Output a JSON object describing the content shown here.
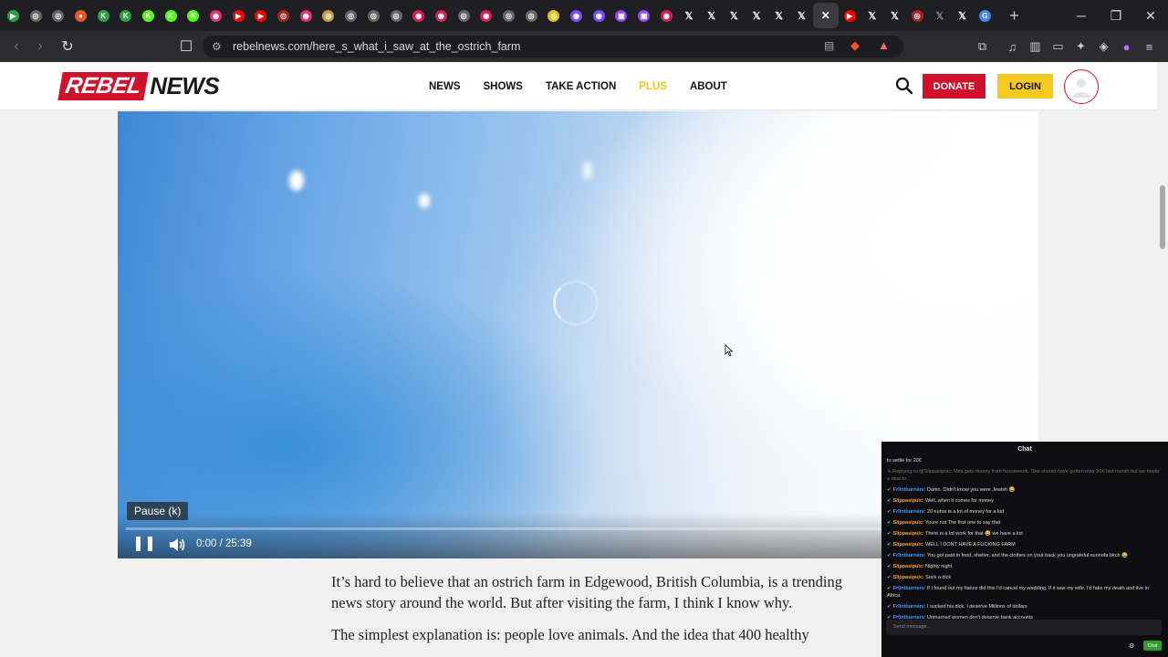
{
  "browser": {
    "tab_favicons": [
      {
        "icon": "play-icon",
        "color": "#2ea043",
        "glyph": "▶"
      },
      {
        "icon": "circle-icon",
        "color": "#666666",
        "glyph": "◎"
      },
      {
        "icon": "circle-icon",
        "color": "#666666",
        "glyph": "◎"
      },
      {
        "icon": "circle-icon",
        "color": "#e05a2a",
        "glyph": "●"
      },
      {
        "icon": "kick-icon",
        "color": "#2ea043",
        "glyph": "K"
      },
      {
        "icon": "kick-icon",
        "color": "#2ea043",
        "glyph": "K"
      },
      {
        "icon": "kick-icon",
        "color": "#53fc18",
        "glyph": "K"
      },
      {
        "icon": "kick-icon",
        "color": "#53fc18",
        "glyph": "K"
      },
      {
        "icon": "kick-icon",
        "color": "#53fc18",
        "glyph": "K"
      },
      {
        "icon": "instagram-icon",
        "color": "#e1306c",
        "glyph": "◉"
      },
      {
        "icon": "youtube-icon",
        "color": "#ff0000",
        "glyph": "▶"
      },
      {
        "icon": "youtube-icon",
        "color": "#ff0000",
        "glyph": "▶"
      },
      {
        "icon": "circle-icon",
        "color": "#aa2222",
        "glyph": "◎"
      },
      {
        "icon": "instagram-icon",
        "color": "#e1306c",
        "glyph": "◉"
      },
      {
        "icon": "circle-icon",
        "color": "#c0a040",
        "glyph": "◎"
      },
      {
        "icon": "circle-icon",
        "color": "#666666",
        "glyph": "◎"
      },
      {
        "icon": "circle-icon",
        "color": "#666666",
        "glyph": "◎"
      },
      {
        "icon": "circle-icon",
        "color": "#666666",
        "glyph": "◎"
      },
      {
        "icon": "circle-icon",
        "color": "#cc2255",
        "glyph": "◉"
      },
      {
        "icon": "circle-icon",
        "color": "#cc2255",
        "glyph": "◉"
      },
      {
        "icon": "circle-icon",
        "color": "#666666",
        "glyph": "◎"
      },
      {
        "icon": "circle-icon",
        "color": "#cc2255",
        "glyph": "◉"
      },
      {
        "icon": "circle-icon",
        "color": "#666666",
        "glyph": "◎"
      },
      {
        "icon": "circle-icon",
        "color": "#666666",
        "glyph": "◎"
      },
      {
        "icon": "circle-icon",
        "color": "#e0c020",
        "glyph": "◎"
      },
      {
        "icon": "circle-icon",
        "color": "#7b4bff",
        "glyph": "◉"
      },
      {
        "icon": "circle-icon",
        "color": "#7b4bff",
        "glyph": "◉"
      },
      {
        "icon": "twitch-icon",
        "color": "#9146ff",
        "glyph": "▣"
      },
      {
        "icon": "twitch-icon",
        "color": "#9146ff",
        "glyph": "▣"
      },
      {
        "icon": "circle-icon",
        "color": "#cc2255",
        "glyph": "◉"
      },
      {
        "icon": "x-icon",
        "color": "#ffffff",
        "glyph": "𝕏"
      },
      {
        "icon": "x-icon",
        "color": "#ffffff",
        "glyph": "𝕏"
      },
      {
        "icon": "x-icon",
        "color": "#ffffff",
        "glyph": "𝕏"
      },
      {
        "icon": "x-icon",
        "color": "#ffffff",
        "glyph": "𝕏"
      },
      {
        "icon": "x-icon",
        "color": "#ffffff",
        "glyph": "𝕏"
      },
      {
        "icon": "x-icon",
        "color": "#ffffff",
        "glyph": "𝕏"
      },
      {
        "icon": "close-icon",
        "color": "#ffffff",
        "glyph": "✕",
        "active": true
      },
      {
        "icon": "youtube-icon",
        "color": "#ff0000",
        "glyph": "▶"
      },
      {
        "icon": "x-icon",
        "color": "#ffffff",
        "glyph": "𝕏"
      },
      {
        "icon": "x-icon",
        "color": "#ffffff",
        "glyph": "𝕏"
      },
      {
        "icon": "circle-icon",
        "color": "#aa2222",
        "glyph": "◎"
      },
      {
        "icon": "x-icon",
        "color": "#888888",
        "glyph": "𝕏"
      },
      {
        "icon": "x-icon",
        "color": "#ffffff",
        "glyph": "𝕏"
      },
      {
        "icon": "google-icon",
        "color": "#4285f4",
        "glyph": "G"
      }
    ],
    "url": "rebelnews.com/here_s_what_i_saw_at_the_ostrich_farm"
  },
  "site": {
    "logo_rebel": "REBEL",
    "logo_news": "NEWS",
    "nav": [
      {
        "label": "NEWS"
      },
      {
        "label": "SHOWS"
      },
      {
        "label": "TAKE ACTION"
      },
      {
        "label": "PLUS",
        "accent": "#f1c40f"
      },
      {
        "label": "ABOUT"
      }
    ],
    "donate_label": "DONATE",
    "login_label": "LOGIN",
    "brand_color": "#d0112b",
    "login_color": "#f7c81e"
  },
  "video": {
    "tooltip": "Pause (k)",
    "time": "0:00 / 25:39",
    "progress": 0
  },
  "article": {
    "paragraphs": [
      "It’s hard to believe that an ostrich farm in Edgewood, British Columbia, is a trending news story around the world. But after visiting the farm, I think I know why.",
      "The simplest explanation is: people love animals. And the idea that 400 healthy"
    ]
  },
  "chat": {
    "title": "Chat",
    "lines": [
      {
        "user": "",
        "text": "to settle for 20€",
        "type": "plain"
      },
      {
        "user": "",
        "text": "↳ Replying to @Slippasipulc: Mini gets money from hossiework. She should have gotten over 80€ last month but we made a deal to…",
        "type": "reply"
      },
      {
        "user": "Fr0ntburners",
        "text": "Damn. Didn't know you were Jewish 😂",
        "type": "u1"
      },
      {
        "user": "Slippasipulc",
        "text": "Well..when it comes for money",
        "type": "u2"
      },
      {
        "user": "Fr0ntburners",
        "text": "20 euros is a lot of money for a kid",
        "type": "u1"
      },
      {
        "user": "Slippasipulc",
        "text": "Youre not The first one to say that",
        "type": "u2"
      },
      {
        "user": "Slippasipulc",
        "text": "There is a lot work for that 😂 we have a list",
        "type": "u2"
      },
      {
        "user": "Slippasipulc",
        "text": "WELL I DONT HAVE A FUCKING FARM",
        "type": "u2"
      },
      {
        "user": "Fr0ntburners",
        "text": "You got paid in food, shelter, and the clothes on your back you ungrateful sunnofa bitch 😂",
        "type": "u1"
      },
      {
        "user": "Slippasipulc",
        "text": "Nighty night",
        "type": "u2"
      },
      {
        "user": "Slippasipulc",
        "text": "Suck a dick",
        "type": "u2"
      },
      {
        "user": "Fr0ntburners",
        "text": "If I found out my fiance did this I'd cancel my wedding. If it was my wife, I'd fake my death and live in Africa",
        "type": "u1"
      },
      {
        "user": "Fr0ntburners",
        "text": "I sucked his dick. I deserve Millions of dollars",
        "type": "u1"
      },
      {
        "user": "Fr0ntburners",
        "text": "Unmarried women don't deserve bank accounts",
        "type": "u1"
      }
    ],
    "input_placeholder": "Send message...",
    "send_label": "Chat"
  }
}
